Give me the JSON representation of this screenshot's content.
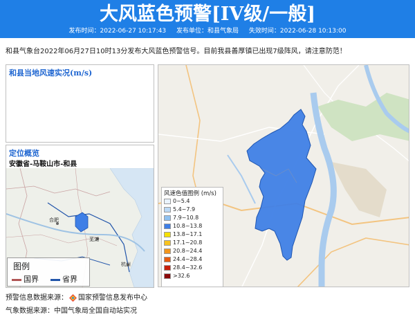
{
  "header": {
    "title": "大风蓝色预警[IV级/一般]",
    "publish_time_label": "发布时间：",
    "publish_time": "2022-06-27 10:17:43",
    "publisher_label": "发布单位：",
    "publisher": "和县气象局",
    "expire_time_label": "失效时间：",
    "expire_time": "2022-06-28 10:13:00"
  },
  "intro": "和县气象台2022年06月27日10时13分发布大风蓝色预警信号。目前我县善厚镇已出现7级阵风，请注意防范！",
  "wind_panel": {
    "title": "和县当地风速实况(m/s)"
  },
  "location_panel": {
    "title": "定位概览",
    "location": "安徽省-马鞍山市-和县"
  },
  "overview_map": {
    "labels": [
      "合肥",
      "芜湖",
      "杭州"
    ],
    "legend": {
      "title": "图例",
      "items": [
        {
          "label": "国界",
          "color": "#b05555"
        },
        {
          "label": "省界",
          "color": "#2255aa"
        }
      ]
    }
  },
  "speed_legend": {
    "title": "风速色值图例 (m/s)",
    "items": [
      {
        "label": "0~5.4",
        "color": "#eaf3ff"
      },
      {
        "label": "5.4~7.9",
        "color": "#bcd9f5"
      },
      {
        "label": "7.9~10.8",
        "color": "#8fc1f0"
      },
      {
        "label": "10.8~13.8",
        "color": "#3f7fe6"
      },
      {
        "label": "13.8~17.1",
        "color": "#f5e000"
      },
      {
        "label": "17.1~20.8",
        "color": "#f8c320"
      },
      {
        "label": "20.8~24.4",
        "color": "#f3961c"
      },
      {
        "label": "24.4~28.4",
        "color": "#e85d10"
      },
      {
        "label": "28.4~32.6",
        "color": "#c8200c"
      },
      {
        "label": ">32.6",
        "color": "#8a0a0a"
      }
    ]
  },
  "footer": {
    "source_label": "预警信息数据来源：",
    "source": "国家预警信息发布中心",
    "weather_label": "气象数据来源：",
    "weather": "中国气象局全国自动站实况"
  },
  "colors": {
    "accent": "#1f7fe6",
    "warning_area": "#3f7fe6"
  }
}
